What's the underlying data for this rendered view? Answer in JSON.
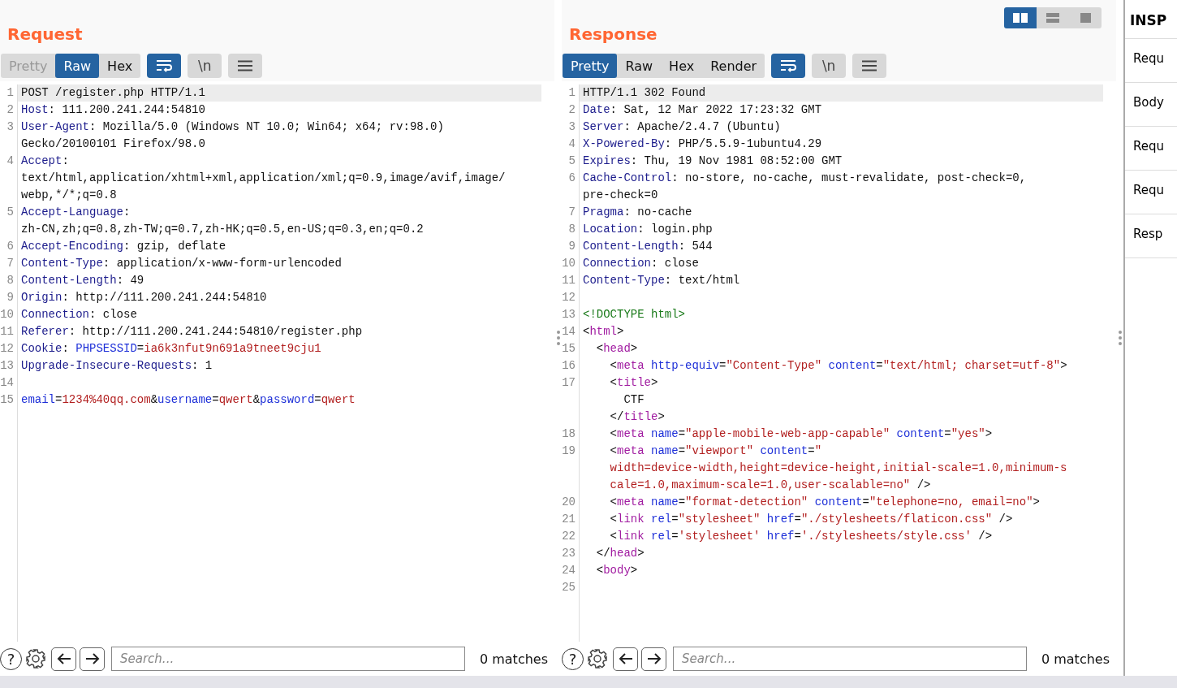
{
  "request": {
    "title": "Request",
    "tabs": [
      {
        "label": "Pretty",
        "selected": false,
        "disabled": true
      },
      {
        "label": "Raw",
        "selected": true,
        "disabled": false
      },
      {
        "label": "Hex",
        "selected": false,
        "disabled": false
      }
    ],
    "toggles": [
      {
        "kind": "wrap",
        "on": true
      },
      {
        "kind": "newline",
        "label": "\\n",
        "on": false
      },
      {
        "kind": "menu",
        "on": false
      }
    ],
    "lines": [
      {
        "n": "1",
        "current": true,
        "rows": [
          {
            "parts": [
              {
                "kind": "text",
                "text": "POST /register.php HTTP/1.1"
              }
            ]
          }
        ]
      },
      {
        "n": "2",
        "current": false,
        "rows": [
          {
            "parts": [
              {
                "kind": "key",
                "text": "Host"
              },
              {
                "kind": "text",
                "text": ": 111.200.241.244:54810"
              }
            ]
          }
        ]
      },
      {
        "n": "3",
        "current": false,
        "rows": [
          {
            "parts": [
              {
                "kind": "key",
                "text": "User-Agent"
              },
              {
                "kind": "text",
                "text": ": Mozilla/5.0 (Windows NT 10.0; Win64; x64; rv:98.0)"
              }
            ]
          },
          {
            "parts": [
              {
                "kind": "text",
                "text": "Gecko/20100101 Firefox/98.0"
              }
            ]
          }
        ]
      },
      {
        "n": "4",
        "current": false,
        "rows": [
          {
            "parts": [
              {
                "kind": "key",
                "text": "Accept"
              },
              {
                "kind": "text",
                "text": ":"
              }
            ]
          },
          {
            "parts": [
              {
                "kind": "text",
                "text": "text/html,application/xhtml+xml,application/xml;q=0.9,image/avif,image/"
              }
            ]
          },
          {
            "parts": [
              {
                "kind": "text",
                "text": "webp,*/*;q=0.8"
              }
            ]
          }
        ]
      },
      {
        "n": "5",
        "current": false,
        "rows": [
          {
            "parts": [
              {
                "kind": "key",
                "text": "Accept-Language"
              },
              {
                "kind": "text",
                "text": ":"
              }
            ]
          },
          {
            "parts": [
              {
                "kind": "text",
                "text": "zh-CN,zh;q=0.8,zh-TW;q=0.7,zh-HK;q=0.5,en-US;q=0.3,en;q=0.2"
              }
            ]
          }
        ]
      },
      {
        "n": "6",
        "current": false,
        "rows": [
          {
            "parts": [
              {
                "kind": "key",
                "text": "Accept-Encoding"
              },
              {
                "kind": "text",
                "text": ": gzip, deflate"
              }
            ]
          }
        ]
      },
      {
        "n": "7",
        "current": false,
        "rows": [
          {
            "parts": [
              {
                "kind": "key",
                "text": "Content-Type"
              },
              {
                "kind": "text",
                "text": ": application/x-www-form-urlencoded"
              }
            ]
          }
        ]
      },
      {
        "n": "8",
        "current": false,
        "rows": [
          {
            "parts": [
              {
                "kind": "key",
                "text": "Content-Length"
              },
              {
                "kind": "text",
                "text": ": 49"
              }
            ]
          }
        ]
      },
      {
        "n": "9",
        "current": false,
        "rows": [
          {
            "parts": [
              {
                "kind": "key",
                "text": "Origin"
              },
              {
                "kind": "text",
                "text": ": http://111.200.241.244:54810"
              }
            ]
          }
        ]
      },
      {
        "n": "10",
        "current": false,
        "rows": [
          {
            "parts": [
              {
                "kind": "key",
                "text": "Connection"
              },
              {
                "kind": "text",
                "text": ": close"
              }
            ]
          }
        ]
      },
      {
        "n": "11",
        "current": false,
        "rows": [
          {
            "parts": [
              {
                "kind": "key",
                "text": "Referer"
              },
              {
                "kind": "text",
                "text": ": http://111.200.241.244:54810/register.php"
              }
            ]
          }
        ]
      },
      {
        "n": "12",
        "current": false,
        "rows": [
          {
            "parts": [
              {
                "kind": "key",
                "text": "Cookie"
              },
              {
                "kind": "text",
                "text": ": "
              },
              {
                "kind": "attr",
                "text": "PHPSESSID"
              },
              {
                "kind": "text",
                "text": "="
              },
              {
                "kind": "value",
                "text": "ia6k3nfut9n691a9tneet9cju1"
              }
            ]
          }
        ]
      },
      {
        "n": "13",
        "current": false,
        "rows": [
          {
            "parts": [
              {
                "kind": "key",
                "text": "Upgrade-Insecure-Requests"
              },
              {
                "kind": "text",
                "text": ": 1"
              }
            ]
          }
        ]
      },
      {
        "n": "14",
        "current": false
      },
      {
        "n": "15",
        "current": false,
        "rows": [
          {
            "parts": [
              {
                "kind": "attr",
                "text": "email"
              },
              {
                "kind": "text",
                "text": "="
              },
              {
                "kind": "value",
                "text": "1234%40qq.com"
              },
              {
                "kind": "text",
                "text": "&"
              },
              {
                "kind": "attr",
                "text": "username"
              },
              {
                "kind": "text",
                "text": "="
              },
              {
                "kind": "value",
                "text": "qwert"
              },
              {
                "kind": "text",
                "text": "&"
              },
              {
                "kind": "attr",
                "text": "password"
              },
              {
                "kind": "text",
                "text": "="
              },
              {
                "kind": "value",
                "text": "qwert"
              }
            ]
          }
        ]
      }
    ],
    "search": {
      "help": "?",
      "placeholder": "Search...",
      "matches": "0 matches"
    }
  },
  "response": {
    "title": "Response",
    "layout_buttons": [
      {
        "kind": "columns",
        "selected": true
      },
      {
        "kind": "rows",
        "selected": false
      },
      {
        "kind": "single",
        "selected": false
      }
    ],
    "tabs": [
      {
        "label": "Pretty",
        "selected": true,
        "disabled": false
      },
      {
        "label": "Raw",
        "selected": false,
        "disabled": false
      },
      {
        "label": "Hex",
        "selected": false,
        "disabled": false
      },
      {
        "label": "Render",
        "selected": false,
        "disabled": false
      }
    ],
    "toggles": [
      {
        "kind": "wrap",
        "on": true
      },
      {
        "kind": "newline",
        "label": "\\n",
        "on": false
      },
      {
        "kind": "menu",
        "on": false
      }
    ],
    "lines": [
      {
        "n": "1",
        "current": true,
        "rows": [
          {
            "parts": [
              {
                "kind": "text",
                "text": "HTTP/1.1 302 Found"
              }
            ]
          }
        ]
      },
      {
        "n": "2",
        "current": false,
        "rows": [
          {
            "parts": [
              {
                "kind": "key",
                "text": "Date"
              },
              {
                "kind": "text",
                "text": ": Sat, 12 Mar 2022 17:23:32 GMT"
              }
            ]
          }
        ]
      },
      {
        "n": "3",
        "current": false,
        "rows": [
          {
            "parts": [
              {
                "kind": "key",
                "text": "Server"
              },
              {
                "kind": "text",
                "text": ": Apache/2.4.7 (Ubuntu)"
              }
            ]
          }
        ]
      },
      {
        "n": "4",
        "current": false,
        "rows": [
          {
            "parts": [
              {
                "kind": "key",
                "text": "X-Powered-By"
              },
              {
                "kind": "text",
                "text": ": PHP/5.5.9-1ubuntu4.29"
              }
            ]
          }
        ]
      },
      {
        "n": "5",
        "current": false,
        "rows": [
          {
            "parts": [
              {
                "kind": "key",
                "text": "Expires"
              },
              {
                "kind": "text",
                "text": ": Thu, 19 Nov 1981 08:52:00 GMT"
              }
            ]
          }
        ]
      },
      {
        "n": "6",
        "current": false,
        "rows": [
          {
            "parts": [
              {
                "kind": "key",
                "text": "Cache-Control"
              },
              {
                "kind": "text",
                "text": ": no-store, no-cache, must-revalidate, post-check=0,"
              }
            ]
          },
          {
            "parts": [
              {
                "kind": "text",
                "text": "pre-check=0"
              }
            ]
          }
        ]
      },
      {
        "n": "7",
        "current": false,
        "rows": [
          {
            "parts": [
              {
                "kind": "key",
                "text": "Pragma"
              },
              {
                "kind": "text",
                "text": ": no-cache"
              }
            ]
          }
        ]
      },
      {
        "n": "8",
        "current": false,
        "rows": [
          {
            "parts": [
              {
                "kind": "key",
                "text": "Location"
              },
              {
                "kind": "text",
                "text": ": login.php"
              }
            ]
          }
        ]
      },
      {
        "n": "9",
        "current": false,
        "rows": [
          {
            "parts": [
              {
                "kind": "key",
                "text": "Content-Length"
              },
              {
                "kind": "text",
                "text": ": 544"
              }
            ]
          }
        ]
      },
      {
        "n": "10",
        "current": false,
        "rows": [
          {
            "parts": [
              {
                "kind": "key",
                "text": "Connection"
              },
              {
                "kind": "text",
                "text": ": close"
              }
            ]
          }
        ]
      },
      {
        "n": "11",
        "current": false,
        "rows": [
          {
            "parts": [
              {
                "kind": "key",
                "text": "Content-Type"
              },
              {
                "kind": "text",
                "text": ": text/html"
              }
            ]
          }
        ]
      },
      {
        "n": "12",
        "current": false
      },
      {
        "n": "13",
        "current": false,
        "rows": [
          {
            "parts": [
              {
                "kind": "doctype",
                "text": "<!DOCTYPE html>"
              }
            ]
          }
        ]
      },
      {
        "n": "14",
        "current": false,
        "rows": [
          {
            "parts": [
              {
                "kind": "text",
                "text": "<"
              },
              {
                "kind": "tag",
                "text": "html"
              },
              {
                "kind": "text",
                "text": ">"
              }
            ]
          }
        ]
      },
      {
        "n": "15",
        "current": false,
        "rows": [
          {
            "parts": [
              {
                "kind": "text",
                "text": "  <"
              },
              {
                "kind": "tag",
                "text": "head"
              },
              {
                "kind": "text",
                "text": ">"
              }
            ]
          }
        ]
      },
      {
        "n": "16",
        "current": false,
        "rows": [
          {
            "parts": [
              {
                "kind": "text",
                "text": "    <"
              },
              {
                "kind": "tag",
                "text": "meta"
              },
              {
                "kind": "attr",
                "text": " http-equiv"
              },
              {
                "kind": "text",
                "text": "="
              },
              {
                "kind": "value",
                "text": "\"Content-Type\""
              },
              {
                "kind": "attr",
                "text": " content"
              },
              {
                "kind": "text",
                "text": "="
              },
              {
                "kind": "value",
                "text": "\"text/html; charset=utf-8\""
              },
              {
                "kind": "text",
                "text": ">"
              }
            ]
          }
        ]
      },
      {
        "n": "17",
        "current": false,
        "rows": [
          {
            "parts": [
              {
                "kind": "text",
                "text": "    <"
              },
              {
                "kind": "tag",
                "text": "title"
              },
              {
                "kind": "text",
                "text": ">"
              }
            ]
          },
          {
            "parts": [
              {
                "kind": "text",
                "text": "      CTF"
              }
            ]
          },
          {
            "parts": [
              {
                "kind": "text",
                "text": "    </"
              },
              {
                "kind": "tag",
                "text": "title"
              },
              {
                "kind": "text",
                "text": ">"
              }
            ]
          }
        ]
      },
      {
        "n": "18",
        "current": false,
        "rows": [
          {
            "parts": [
              {
                "kind": "text",
                "text": "    <"
              },
              {
                "kind": "tag",
                "text": "meta"
              },
              {
                "kind": "attr",
                "text": " name"
              },
              {
                "kind": "text",
                "text": "="
              },
              {
                "kind": "value",
                "text": "\"apple-mobile-web-app-capable\""
              },
              {
                "kind": "attr",
                "text": " content"
              },
              {
                "kind": "text",
                "text": "="
              },
              {
                "kind": "value",
                "text": "\"yes\""
              },
              {
                "kind": "text",
                "text": ">"
              }
            ]
          }
        ]
      },
      {
        "n": "19",
        "current": false,
        "rows": [
          {
            "parts": [
              {
                "kind": "text",
                "text": "    <"
              },
              {
                "kind": "tag",
                "text": "meta"
              },
              {
                "kind": "attr",
                "text": " name"
              },
              {
                "kind": "text",
                "text": "="
              },
              {
                "kind": "value",
                "text": "\"viewport\""
              },
              {
                "kind": "attr",
                "text": " content"
              },
              {
                "kind": "text",
                "text": "="
              },
              {
                "kind": "value",
                "text": "\""
              }
            ]
          },
          {
            "parts": [
              {
                "kind": "value",
                "text": "    width=device-width,height=device-height,initial-scale=1.0,minimum-s"
              }
            ]
          },
          {
            "parts": [
              {
                "kind": "value",
                "text": "    cale=1.0,maximum-scale=1.0,user-scalable=no\""
              },
              {
                "kind": "text",
                "text": " />"
              }
            ]
          }
        ]
      },
      {
        "n": "20",
        "current": false,
        "rows": [
          {
            "parts": [
              {
                "kind": "text",
                "text": "    <"
              },
              {
                "kind": "tag",
                "text": "meta"
              },
              {
                "kind": "attr",
                "text": " name"
              },
              {
                "kind": "text",
                "text": "="
              },
              {
                "kind": "value",
                "text": "\"format-detection\""
              },
              {
                "kind": "attr",
                "text": " content"
              },
              {
                "kind": "text",
                "text": "="
              },
              {
                "kind": "value",
                "text": "\"telephone=no, email=no\""
              },
              {
                "kind": "text",
                "text": ">"
              }
            ]
          }
        ]
      },
      {
        "n": "21",
        "current": false,
        "rows": [
          {
            "parts": [
              {
                "kind": "text",
                "text": "    <"
              },
              {
                "kind": "tag",
                "text": "link"
              },
              {
                "kind": "attr",
                "text": " rel"
              },
              {
                "kind": "text",
                "text": "="
              },
              {
                "kind": "value",
                "text": "\"stylesheet\""
              },
              {
                "kind": "attr",
                "text": " href"
              },
              {
                "kind": "text",
                "text": "="
              },
              {
                "kind": "value",
                "text": "\"./stylesheets/flaticon.css\""
              },
              {
                "kind": "text",
                "text": " />"
              }
            ]
          }
        ]
      },
      {
        "n": "22",
        "current": false,
        "rows": [
          {
            "parts": [
              {
                "kind": "text",
                "text": "    <"
              },
              {
                "kind": "tag",
                "text": "link"
              },
              {
                "kind": "attr",
                "text": " rel"
              },
              {
                "kind": "text",
                "text": "="
              },
              {
                "kind": "value",
                "text": "'stylesheet'"
              },
              {
                "kind": "attr",
                "text": " href"
              },
              {
                "kind": "text",
                "text": "="
              },
              {
                "kind": "value",
                "text": "'./stylesheets/style.css'"
              },
              {
                "kind": "text",
                "text": " />"
              }
            ]
          }
        ]
      },
      {
        "n": "23",
        "current": false,
        "rows": [
          {
            "parts": [
              {
                "kind": "text",
                "text": "  </"
              },
              {
                "kind": "tag",
                "text": "head"
              },
              {
                "kind": "text",
                "text": ">"
              }
            ]
          }
        ]
      },
      {
        "n": "24",
        "current": false,
        "rows": [
          {
            "parts": [
              {
                "kind": "text",
                "text": "  <"
              },
              {
                "kind": "tag",
                "text": "body"
              },
              {
                "kind": "text",
                "text": ">"
              }
            ]
          }
        ]
      },
      {
        "n": "25",
        "current": false
      }
    ],
    "search": {
      "help": "?",
      "placeholder": "Search...",
      "matches": "0 matches"
    }
  },
  "inspector": {
    "title": "INSP",
    "items": [
      "Requ",
      "Body",
      "Requ",
      "Requ",
      "Resp"
    ]
  }
}
